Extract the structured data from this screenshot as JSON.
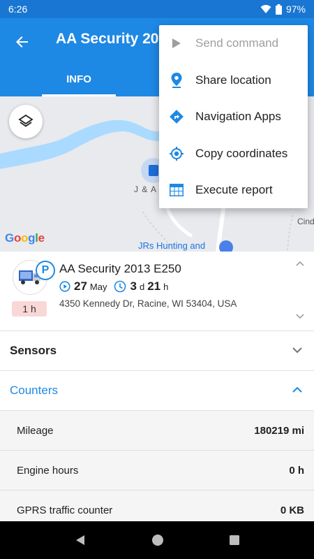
{
  "status_bar": {
    "time": "6:26",
    "battery": "97%"
  },
  "app_bar": {
    "title": "AA Security 20",
    "tab_info": "INFO"
  },
  "map": {
    "label_ja": "J & A",
    "label_cind": "Cind",
    "label_jrs": "JRs Hunting and",
    "google": [
      "G",
      "o",
      "o",
      "g",
      "l",
      "e"
    ]
  },
  "menu": {
    "items": [
      {
        "label": "Send command",
        "icon": "play-icon",
        "enabled": false
      },
      {
        "label": "Share location",
        "icon": "location-pin-icon",
        "enabled": true
      },
      {
        "label": "Navigation Apps",
        "icon": "directions-icon",
        "enabled": true
      },
      {
        "label": "Copy coordinates",
        "icon": "gps-target-icon",
        "enabled": true
      },
      {
        "label": "Execute report",
        "icon": "table-icon",
        "enabled": true
      }
    ]
  },
  "unit": {
    "name": "AA Security 2013 E250",
    "parking_badge": "P",
    "duration_badge": "1 h",
    "date_day": "27",
    "date_month": "May",
    "duration_days": "3",
    "duration_days_unit": "d",
    "duration_hours": "21",
    "duration_hours_unit": "h",
    "address": "4350 Kennedy Dr, Racine, WI 53404, USA"
  },
  "sections": {
    "sensors": "Sensors",
    "counters": "Counters"
  },
  "counters": [
    {
      "label": "Mileage",
      "value": "180219 mi"
    },
    {
      "label": "Engine hours",
      "value": "0 h"
    },
    {
      "label": "GPRS traffic counter",
      "value": "0 KB"
    }
  ],
  "colors": {
    "primary": "#1e88e5",
    "status_bar": "#1976d2",
    "accent": "#1e88e5"
  }
}
